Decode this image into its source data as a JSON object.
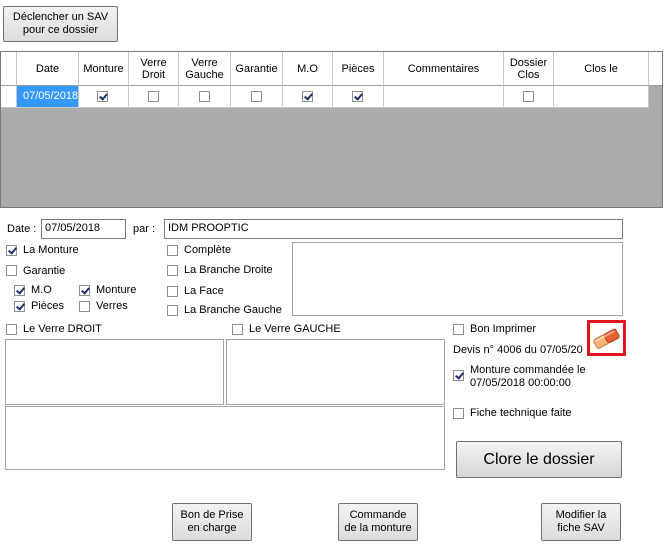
{
  "toolbar": {
    "trigger_sav": "Déclencher un SAV pour ce dossier"
  },
  "grid": {
    "columns": [
      "Date",
      "Monture",
      "Verre Droit",
      "Verre Gauche",
      "Garantie",
      "M.O",
      "Pièces",
      "Commentaires",
      "Dossier Clos",
      "Clos le"
    ],
    "row": {
      "date": "07/05/2018",
      "monture": true,
      "verre_droit": false,
      "verre_gauche": false,
      "garantie": false,
      "mo": true,
      "pieces": true,
      "commentaires": "",
      "dossier_clos": false,
      "clos_le": ""
    }
  },
  "form": {
    "date_label": "Date :",
    "date_value": "07/05/2018",
    "par_label": "par :",
    "par_value": "IDM PROOPTIC",
    "la_monture": "La Monture",
    "garantie": "Garantie",
    "mo": "M.O",
    "monture": "Monture",
    "pieces": "Pièces",
    "verres": "Verres",
    "complete": "Complète",
    "branche_droite": "La Branche Droite",
    "face": "La Face",
    "branche_gauche": "La Branche Gauche",
    "verre_droit": "Le Verre DROIT",
    "verre_gauche": "Le Verre GAUCHE",
    "bon_imprimer": "Bon Imprimer",
    "devis": "Devis n° 4006 du 07/05/20",
    "monture_commandee": "Monture commandée le 07/05/2018 00:00:00",
    "fiche_technique": "Fiche technique faite"
  },
  "actions": {
    "clore": "Clore le dossier",
    "bon_prise": "Bon de Prise en charge",
    "commande": "Commande de la monture",
    "modifier": "Modifier la fiche SAV"
  },
  "colors": {
    "selection": "#3399ff",
    "highlight_box": "#e0141e",
    "grid_bg": "#ababab"
  }
}
